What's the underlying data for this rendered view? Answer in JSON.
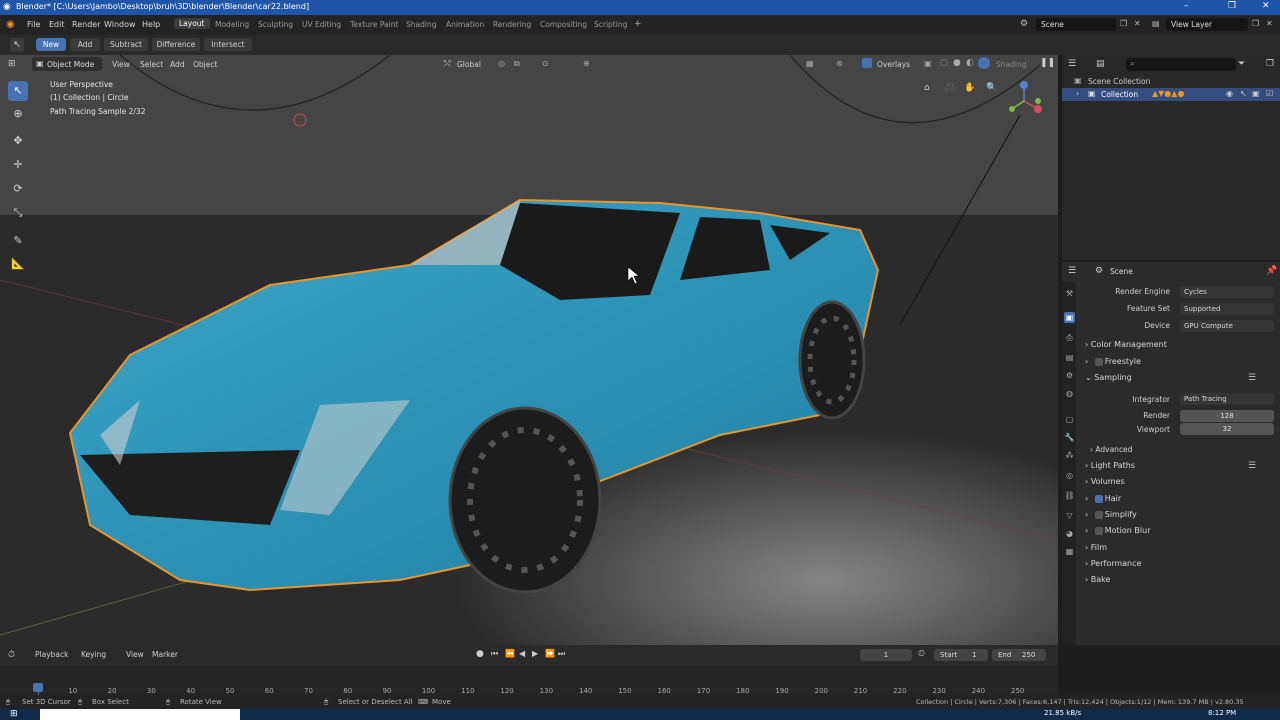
{
  "window": {
    "title": "Blender* [C:\\Users\\Jambo\\Desktop\\bruh\\3D\\blender\\Blender\\car22.blend]"
  },
  "menu": {
    "items": [
      "File",
      "Edit",
      "Render",
      "Window",
      "Help"
    ]
  },
  "workspaces": [
    "Layout",
    "Modeling",
    "Sculpting",
    "UV Editing",
    "Texture Paint",
    "Shading",
    "Animation",
    "Rendering",
    "Compositing",
    "Scripting"
  ],
  "scene": {
    "name": "Scene",
    "view_layer": "View Layer"
  },
  "boolean_tools": [
    "New",
    "Add",
    "Subtract",
    "Difference",
    "Intersect"
  ],
  "viewport": {
    "mode": "Object Mode",
    "menus": [
      "View",
      "Select",
      "Add",
      "Object"
    ],
    "orientation": "Global",
    "overlays_label": "Overlays",
    "shading_label": "Shading",
    "info_lines": [
      "User Perspective",
      "(1) Collection | Circle",
      "Path Tracing Sample 2/32"
    ]
  },
  "outliner": {
    "root": "Scene Collection",
    "collection": "Collection"
  },
  "properties": {
    "context": "Scene",
    "render_engine_label": "Render Engine",
    "render_engine": "Cycles",
    "feature_set_label": "Feature Set",
    "feature_set": "Supported",
    "device_label": "Device",
    "device": "GPU Compute",
    "panels": {
      "color_management": "Color Management",
      "freestyle": "Freestyle",
      "sampling": "Sampling",
      "advanced": "Advanced",
      "light_paths": "Light Paths",
      "volumes": "Volumes",
      "hair": "Hair",
      "simplify": "Simplify",
      "motion_blur": "Motion Blur",
      "film": "Film",
      "performance": "Performance",
      "bake": "Bake"
    },
    "integrator_label": "Integrator",
    "integrator": "Path Tracing",
    "render_samples_label": "Render",
    "render_samples": "128",
    "viewport_samples_label": "Viewport",
    "viewport_samples": "32"
  },
  "timeline": {
    "menus": [
      "Playback",
      "Keying",
      "View",
      "Marker"
    ],
    "current_frame": "1",
    "start_label": "Start",
    "start": "1",
    "end_label": "End",
    "end": "250",
    "ticks": [
      "10",
      "20",
      "30",
      "40",
      "50",
      "60",
      "70",
      "80",
      "90",
      "100",
      "110",
      "120",
      "130",
      "140",
      "150",
      "160",
      "170",
      "180",
      "190",
      "200",
      "210",
      "220",
      "230",
      "240",
      "250"
    ]
  },
  "status": {
    "left": [
      "Set 3D Cursor",
      "Box Select",
      "Rotate View",
      "Select or Deselect All",
      "Move"
    ],
    "stats": "Collection | Circle | Verts:7,306 | Faces:6,147 | Tris:12,424 | Objects:1/12 | Mem: 139.7 MB | v2.80.35"
  },
  "taskbar": {
    "net": "21.85 kB/s",
    "time": "8:12 PM"
  },
  "colors": {
    "accent": "#4772b3",
    "car": "#2a93b8",
    "selection": "#e8952c"
  }
}
